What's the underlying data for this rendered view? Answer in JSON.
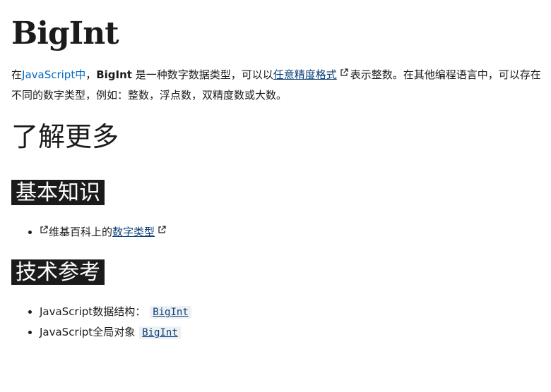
{
  "title": "BigInt",
  "intro": {
    "part1": "在",
    "js_link": "JavaScript中",
    "part2": "，",
    "bold": "BigInt",
    "part3": " 是一种数字数据类型，可以以",
    "precision_link": "任意精度格式",
    "part4": "表示整数。在其他编程语言中，可以存在不同的数字类型，例如：整数，浮点数，双精度数或大数。"
  },
  "learn_more": "了解更多",
  "basic": {
    "heading": "基本知识",
    "items": [
      {
        "prefix": "维基百科上的",
        "link": "数字类型"
      }
    ]
  },
  "tech": {
    "heading": "技术参考",
    "items": [
      {
        "text": "JavaScript数据结构：",
        "code": "BigInt"
      },
      {
        "text": "JavaScript全局对象",
        "code": "BigInt"
      }
    ]
  },
  "colors": {
    "text": "#1b1b1b",
    "link": "#0069c2",
    "link_visited": "#0b3f78",
    "heading_bg": "#1b1b1b",
    "code_bg": "#eef1f4"
  },
  "icons": {
    "external_link": "external-link-icon"
  }
}
